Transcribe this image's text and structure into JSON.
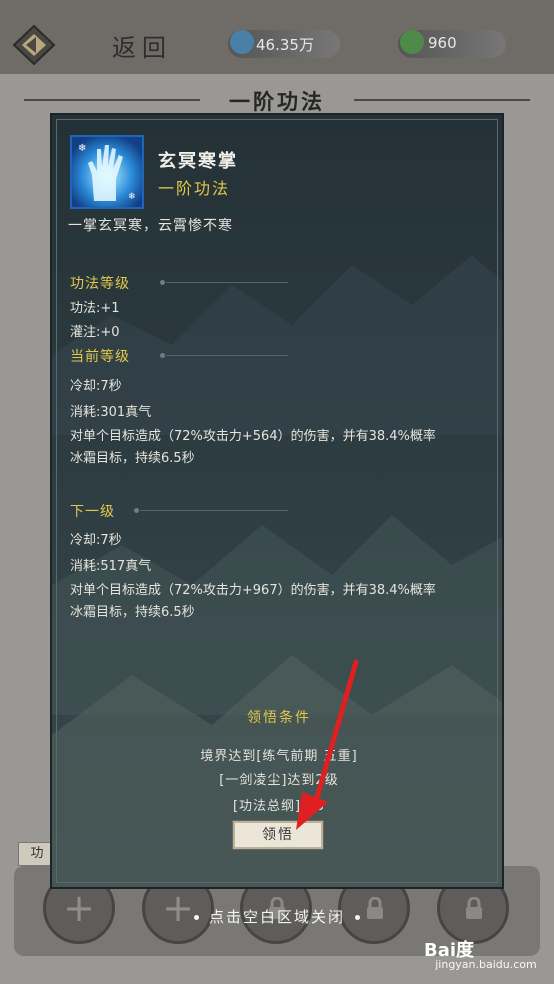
{
  "header": {
    "back_label": "返回",
    "currency_1": "46.35万",
    "currency_2": "960",
    "currency_1_icon": "blue-gem-icon",
    "currency_2_icon": "green-lotus-icon"
  },
  "page": {
    "title": "一阶功法",
    "side_tab_label": "功"
  },
  "skill": {
    "icon": "ice-palm-icon",
    "name": "玄冥寒掌",
    "tier": "一阶功法",
    "description": "一掌玄冥寒，云霄惨不寒"
  },
  "sections": {
    "level": {
      "title": "功法等级",
      "lines": [
        "功法:+1",
        "灌注:+0"
      ]
    },
    "current": {
      "title": "当前等级",
      "cooldown": "冷却:7秒",
      "cost": "消耗:301真气",
      "effect_1": "对单个目标造成（72%攻击力+564）的伤害，并有38.4%概率",
      "effect_2": "冰霜目标，持续6.5秒"
    },
    "next": {
      "title": "下一级",
      "cooldown": "冷却:7秒",
      "cost": "消耗:517真气",
      "effect_1": "对单个目标造成（72%攻击力+967）的伤害，并有38.4%概率",
      "effect_2": "冰霜目标，持续6.5秒"
    }
  },
  "conditions": {
    "title": "领悟条件",
    "items": [
      "境界达到[练气前期 五重]",
      "[一剑凌尘]达到2级",
      "[功法总纲]1/3"
    ]
  },
  "actions": {
    "learn_label": "领悟",
    "close_hint": "点击空白区域关闭"
  },
  "bottom_slots": [
    "add-slot",
    "add-slot",
    "locked-slot",
    "locked-slot",
    "locked-slot"
  ],
  "watermark": {
    "brand": "Bai度",
    "url": "jingyan.baidu.com"
  },
  "colors": {
    "accent_gold": "#e4c84a",
    "modal_bg": "#2c3b40",
    "arrow_red": "#e02020"
  }
}
